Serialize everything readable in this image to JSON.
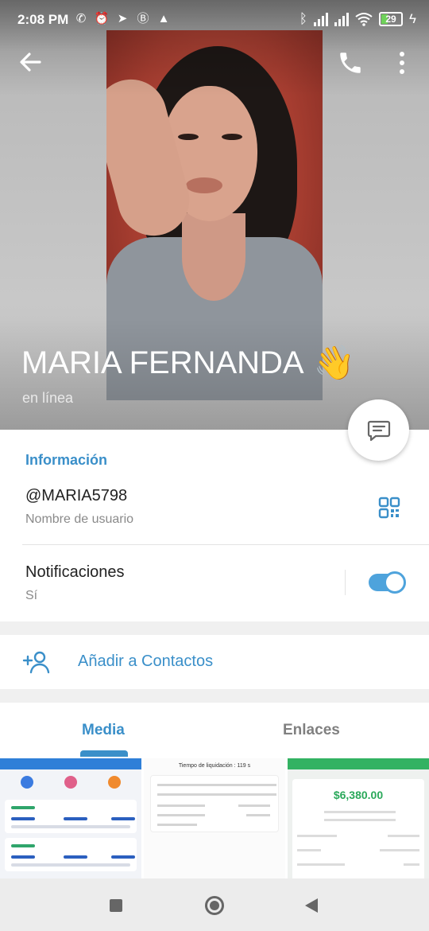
{
  "status_bar": {
    "time": "2:08 PM",
    "battery": "29"
  },
  "profile": {
    "name": "MARIA FERNANDA",
    "emoji": "👋",
    "presence": "en línea"
  },
  "info": {
    "section_title": "Información",
    "username": "@MARIA5798",
    "username_label": "Nombre de usuario",
    "notifications_label": "Notificaciones",
    "notifications_value": "Sí",
    "notifications_enabled": true
  },
  "actions": {
    "add_contact": "Añadir a Contactos"
  },
  "tabs": {
    "media": "Media",
    "links": "Enlaces",
    "active": "Media"
  },
  "media_thumbnails": {
    "thumb2_title": "Tiempo de liquidación : 119 s",
    "thumb3_amount": "$6,380.00"
  },
  "colors": {
    "accent": "#3a8fc9",
    "toggle": "#4ea3dc"
  }
}
